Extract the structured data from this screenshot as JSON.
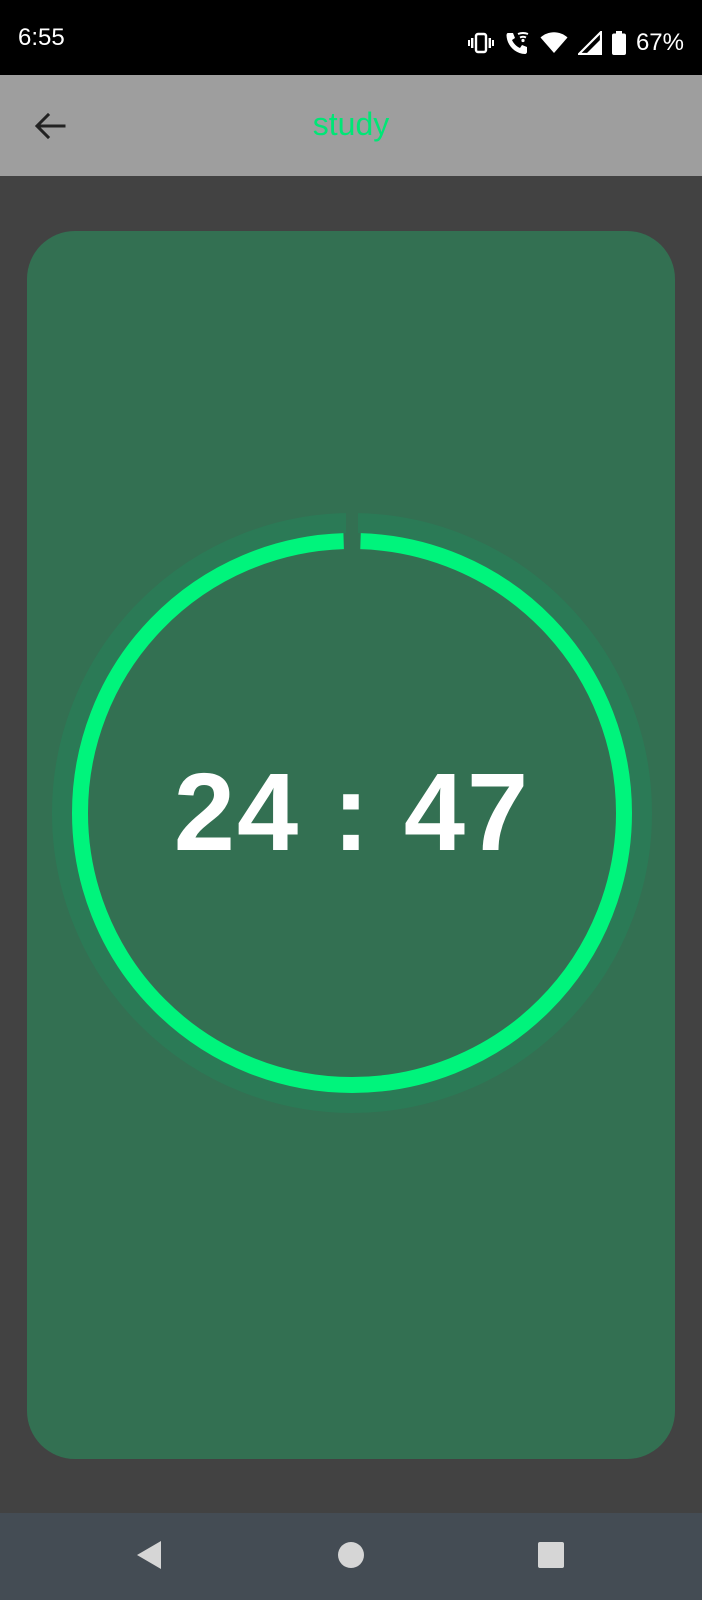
{
  "status_bar": {
    "time": "6:55",
    "battery_percent": "67%",
    "icons": [
      "vibrate-icon",
      "wifi-calling-icon",
      "wifi-icon",
      "signal-icon",
      "battery-icon"
    ]
  },
  "app_bar": {
    "title": "study",
    "back_icon": "arrow-back-icon"
  },
  "timer": {
    "display": "24 : 47",
    "progress_fraction": 0.99
  },
  "nav_bar": {
    "icons": [
      "back-triangle-icon",
      "home-circle-icon",
      "recents-square-icon"
    ]
  },
  "colors": {
    "status_bar_bg": "#000000",
    "app_bar_bg": "#9e9e9e",
    "title_accent": "#00e676",
    "page_bg": "#424242",
    "card_bg": "#337052",
    "ring_track": "#2b7a56",
    "ring_progress": "#00f47c",
    "nav_bar_bg": "#444c54"
  }
}
